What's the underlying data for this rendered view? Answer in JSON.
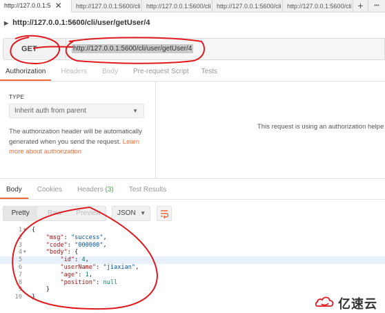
{
  "tabs": [
    {
      "label": "http://127.0.0.1:5",
      "active": true
    },
    {
      "label": "http://127.0.0.1:5600/cli",
      "active": false
    },
    {
      "label": "http://127.0.0.1:5600/cli",
      "active": false
    },
    {
      "label": "http://127.0.0.1:5600/cli",
      "active": false
    },
    {
      "label": "http://127.0.0.1:5600/cli",
      "active": false
    }
  ],
  "tab_close": "✕",
  "tab_add": "+",
  "tab_more": "•••",
  "request": {
    "title": "http://127.0.0.1:5600/cli/user/getUser/4",
    "method": "GET",
    "url": "http://127.0.0.1:5600/cli/user/getUser/4"
  },
  "request_tabs": [
    "Authorization",
    "Headers",
    "Body",
    "Pre-request Script",
    "Tests"
  ],
  "auth": {
    "type_label": "TYPE",
    "type_value": "Inherit auth from parent",
    "description": "The authorization header will be automatically generated when you send the request.",
    "learn_link": "Learn more about authorization",
    "right_message": "This request is using an authorization helpe"
  },
  "response_tabs": {
    "body": "Body",
    "cookies": "Cookies",
    "headers": "Headers",
    "headers_count": "(3)",
    "test_results": "Test Results"
  },
  "view_modes": [
    "Pretty",
    "Raw",
    "Preview"
  ],
  "format": "JSON",
  "code_lines": [
    {
      "n": "1",
      "fold": true
    },
    {
      "n": "2"
    },
    {
      "n": "3"
    },
    {
      "n": "4",
      "fold": true
    },
    {
      "n": "5",
      "highlight": true
    },
    {
      "n": "6"
    },
    {
      "n": "7"
    },
    {
      "n": "8"
    },
    {
      "n": "9"
    },
    {
      "n": "10"
    }
  ],
  "json": {
    "msg_key": "\"msg\"",
    "msg_val": "\"success\"",
    "code_key": "\"code\"",
    "code_val": "\"000000\"",
    "body_key": "\"body\"",
    "id_key": "\"id\"",
    "id_val": "4",
    "user_key": "\"userName\"",
    "user_val": "\"jiaxian\"",
    "age_key": "\"age\"",
    "age_val": "1",
    "pos_key": "\"position\"",
    "pos_val": "null"
  },
  "watermark": "亿速云",
  "colors": {
    "accent": "#f26b3a",
    "annotation": "#e0191e",
    "count_green": "#4caf50"
  }
}
